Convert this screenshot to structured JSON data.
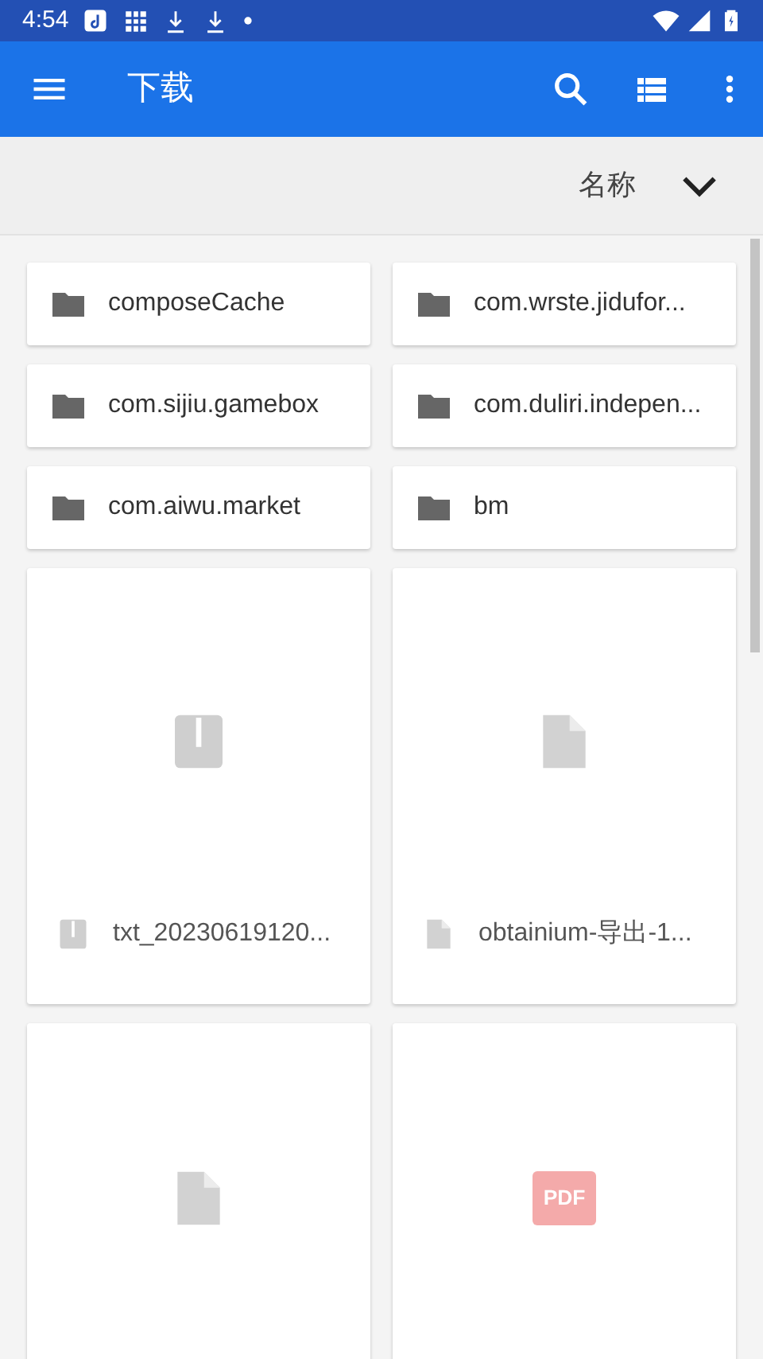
{
  "status_bar": {
    "time": "4:54"
  },
  "app_bar": {
    "title": "下载"
  },
  "sort": {
    "label": "名称"
  },
  "folders": [
    {
      "name": "composeCache"
    },
    {
      "name": "com.wrste.jidufor..."
    },
    {
      "name": "com.sijiu.gamebox"
    },
    {
      "name": "com.duliri.indepen..."
    },
    {
      "name": "com.aiwu.market"
    },
    {
      "name": "bm"
    }
  ],
  "files": [
    {
      "kind": "zip",
      "name": "txt_20230619120..."
    },
    {
      "kind": "doc",
      "name": "obtainium-导出-1..."
    },
    {
      "kind": "doc"
    },
    {
      "kind": "pdf",
      "badge": "PDF"
    }
  ]
}
